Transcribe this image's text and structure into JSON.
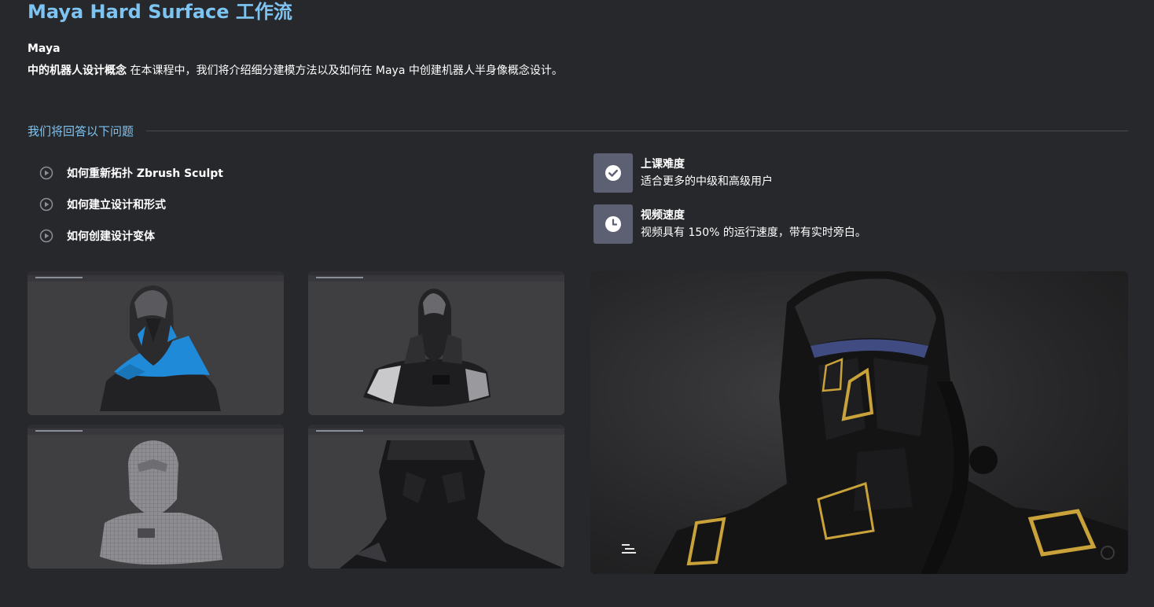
{
  "page": {
    "title": "Maya Hard Surface 工作流",
    "intro_bold_line1": "Maya",
    "intro_bold_line2": "中的机器人设计概念",
    "intro_text": " 在本课程中，我们将介绍细分建模方法以及如何在 Maya 中创建机器人半身像概念设计。"
  },
  "questions": {
    "heading": "我们将回答以下问题",
    "items": [
      {
        "icon": "play-circle-icon",
        "label": "如何重新拓扑 Zbrush Sculpt"
      },
      {
        "icon": "play-circle-icon",
        "label": "如何建立设计和形式"
      },
      {
        "icon": "play-circle-icon",
        "label": "如何创建设计变体"
      }
    ]
  },
  "info": {
    "difficulty": {
      "icon": "check-circle-icon",
      "title": "上课难度",
      "text": "适合更多的中级和高级用户"
    },
    "speed": {
      "icon": "clock-icon",
      "title": "视频速度",
      "text": "视频具有 150% 的运行速度，带有实时旁白。"
    }
  },
  "gallery": {
    "thumbnails": [
      {
        "subject": "robot-bust-blue-retopo"
      },
      {
        "subject": "robot-bust-glossy-black"
      },
      {
        "subject": "robot-bust-wireframe-grey"
      },
      {
        "subject": "robot-bust-dark-closeup"
      }
    ],
    "hero": {
      "subject": "robot-bust-render-gold-accents"
    }
  },
  "colors": {
    "background": "#27282c",
    "accent": "#7ec4f2",
    "icon_tile": "#5d6072",
    "gold": "#c9a23a",
    "blue_topology": "#1f8ad8"
  }
}
